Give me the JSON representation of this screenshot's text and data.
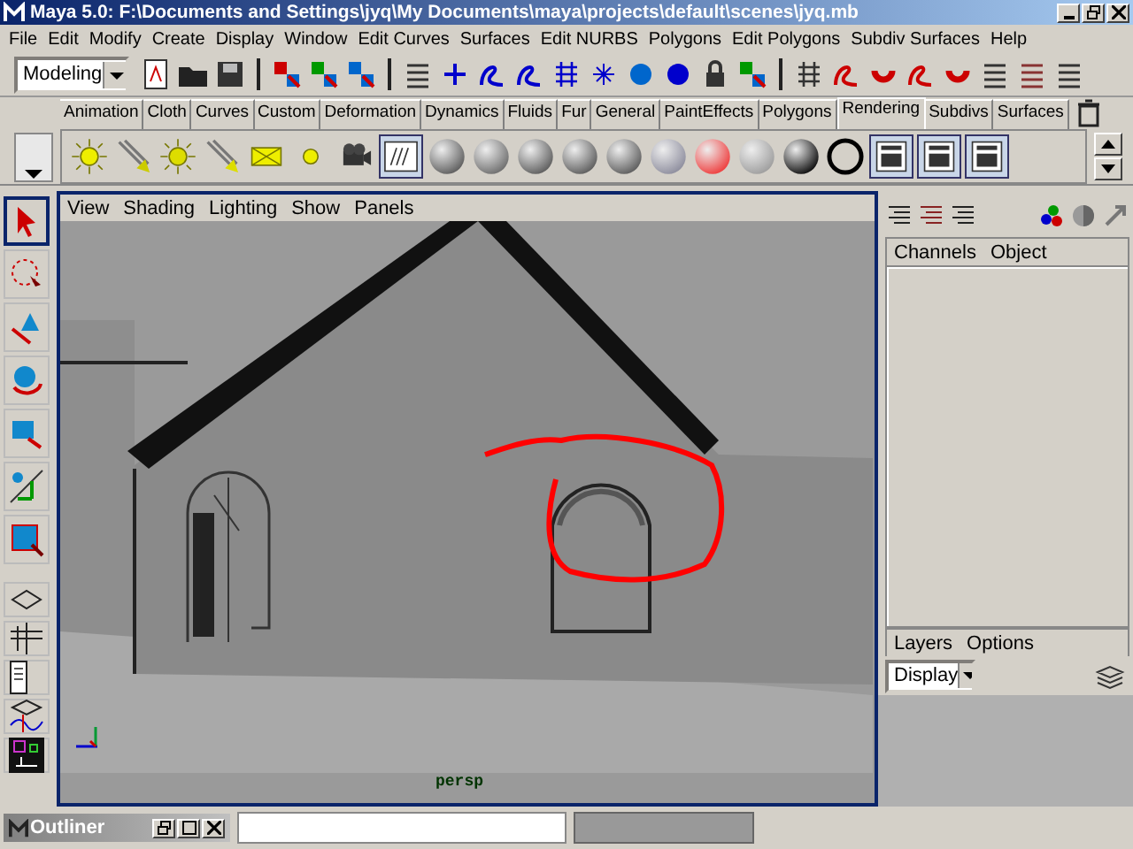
{
  "window": {
    "title": "Maya 5.0: F:\\Documents and Settings\\jyq\\My Documents\\maya\\projects\\default\\scenes\\jyq.mb"
  },
  "menu_bar": [
    "File",
    "Edit",
    "Modify",
    "Create",
    "Display",
    "Window",
    "Edit Curves",
    "Surfaces",
    "Edit NURBS",
    "Polygons",
    "Edit Polygons",
    "Subdiv Surfaces",
    "Help"
  ],
  "mode_selector": {
    "value": "Modeling"
  },
  "shelf_tabs": [
    {
      "label": "Animation",
      "selected": false
    },
    {
      "label": "Cloth",
      "selected": false
    },
    {
      "label": "Curves",
      "selected": false
    },
    {
      "label": "Custom",
      "selected": false
    },
    {
      "label": "Deformation",
      "selected": false
    },
    {
      "label": "Dynamics",
      "selected": false
    },
    {
      "label": "Fluids",
      "selected": false
    },
    {
      "label": "Fur",
      "selected": false
    },
    {
      "label": "General",
      "selected": false
    },
    {
      "label": "PaintEffects",
      "selected": false
    },
    {
      "label": "Polygons",
      "selected": false
    },
    {
      "label": "Rendering",
      "selected": true
    },
    {
      "label": "Subdivs",
      "selected": false
    },
    {
      "label": "Surfaces",
      "selected": false
    }
  ],
  "toolbox": [
    {
      "selected": true
    },
    {
      "selected": false
    },
    {
      "selected": false
    },
    {
      "selected": false
    },
    {
      "selected": false
    },
    {
      "selected": false
    },
    {
      "selected": false
    }
  ],
  "viewport": {
    "menus": [
      "View",
      "Shading",
      "Lighting",
      "Show",
      "Panels"
    ],
    "camera_label": "persp"
  },
  "channel_box": {
    "menus": [
      "Channels",
      "Object"
    ]
  },
  "layer_editor": {
    "menus": [
      "Layers",
      "Options"
    ],
    "display_selector": {
      "value": "Display"
    }
  },
  "outliner": {
    "title": "Outliner"
  }
}
